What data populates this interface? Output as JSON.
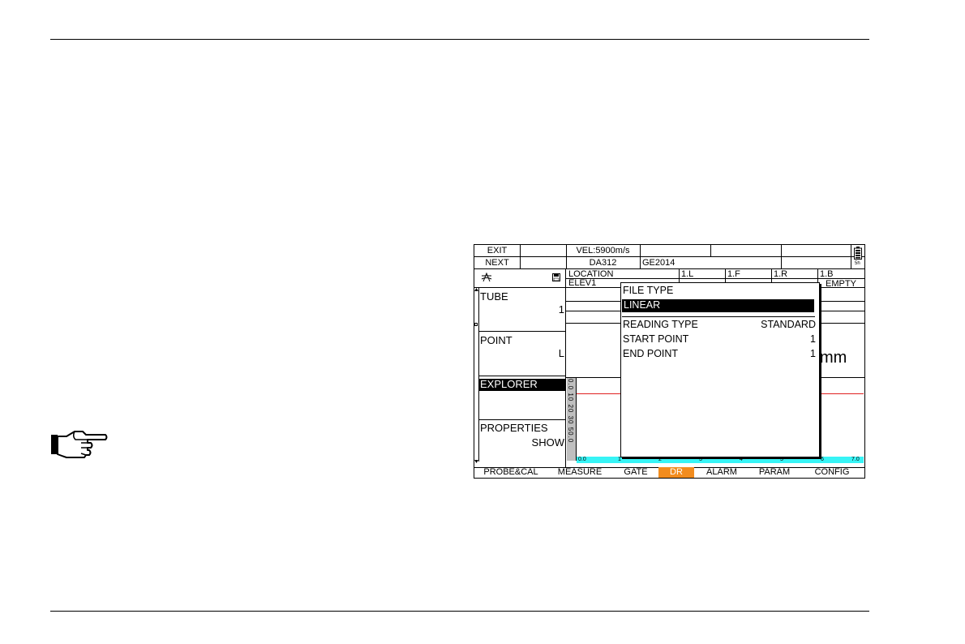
{
  "header": {
    "exit": "EXIT",
    "next": "NEXT",
    "velocity": "VEL:5900m/s",
    "probe": "DA312",
    "file_name": "GE2014",
    "battery_label": "5h"
  },
  "menu": {
    "tube_label": "TUBE",
    "tube_value": "1",
    "point_label": "POINT",
    "point_value": "L",
    "explorer_label": "EXPLORER",
    "properties_label": "PROPERTIES",
    "properties_value": "SHOW"
  },
  "grid": {
    "location_header": "LOCATION",
    "columns": [
      "1.L",
      "1.F",
      "1.R",
      "1.B"
    ],
    "row1_location": "ELEV1",
    "row1_last": "EMPTY"
  },
  "reading_unit": "mm",
  "scale_left": "0.0 10 20 30 50.0",
  "scale_bottom": [
    "0.0",
    "1",
    "2",
    "3",
    "4",
    "5",
    "6",
    "7.0"
  ],
  "popup": {
    "file_type_label": "FILE TYPE",
    "file_type_value": "LINEAR",
    "reading_type_label": "READING TYPE",
    "reading_type_value": "STANDARD",
    "start_point_label": "START POINT",
    "start_point_value": "1",
    "end_point_label": "END POINT",
    "end_point_value": "1"
  },
  "tabs": [
    "PROBE&CAL",
    "MEASURE",
    "GATE",
    "DR",
    "ALARM",
    "PARAM",
    "CONFIG"
  ],
  "active_tab": "DR",
  "colors": {
    "active_tab": "#f28c1e",
    "scale_bar": "#37f4f6",
    "reference_line": "#e02020"
  }
}
